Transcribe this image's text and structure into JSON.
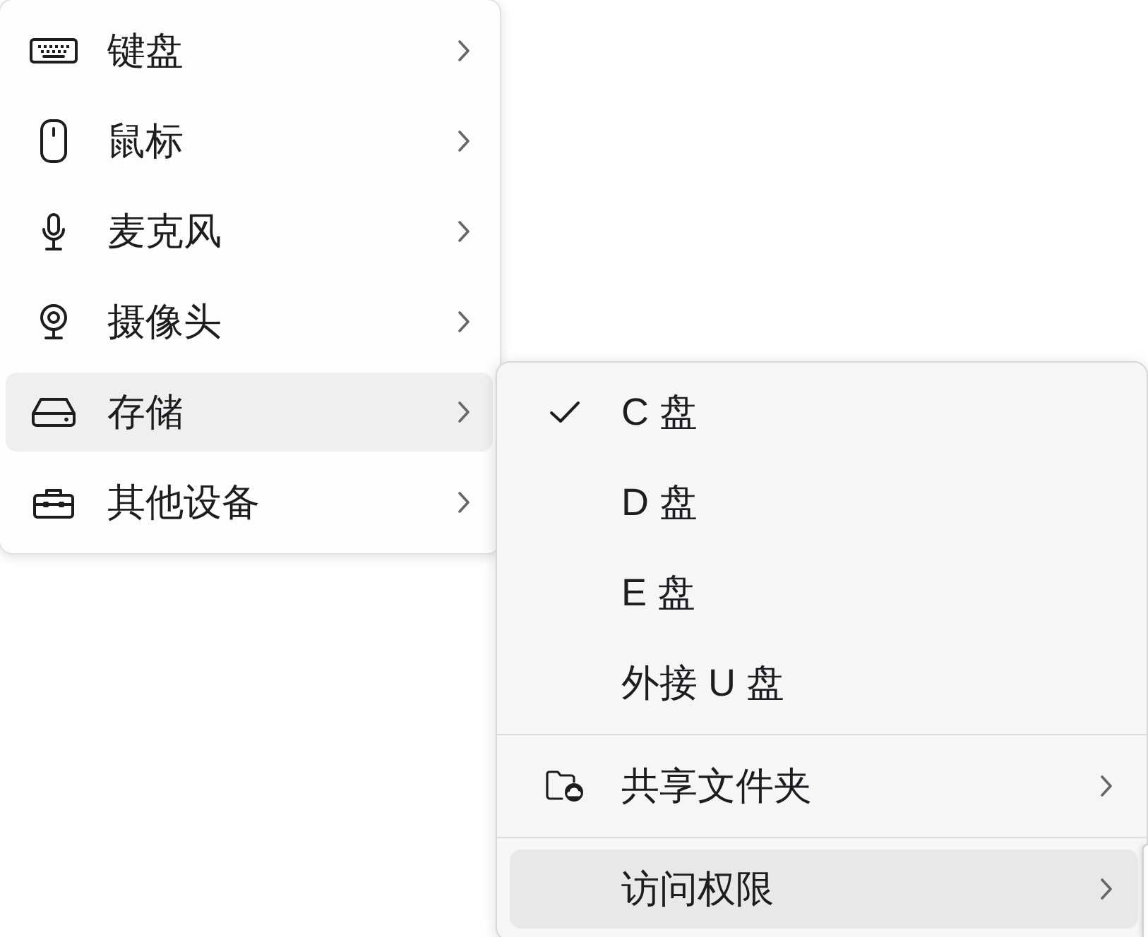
{
  "menu": {
    "items": [
      {
        "label": "键盘",
        "selected": false,
        "has_submenu": true
      },
      {
        "label": "鼠标",
        "selected": false,
        "has_submenu": true
      },
      {
        "label": "麦克风",
        "selected": false,
        "has_submenu": true
      },
      {
        "label": "摄像头",
        "selected": false,
        "has_submenu": true
      },
      {
        "label": "存储",
        "selected": true,
        "has_submenu": true
      },
      {
        "label": "其他设备",
        "selected": false,
        "has_submenu": true
      }
    ]
  },
  "submenu": {
    "groups": [
      {
        "items": [
          {
            "label": "C 盘",
            "checked": true,
            "selected": false,
            "has_submenu": false
          },
          {
            "label": "D 盘",
            "checked": false,
            "selected": false,
            "has_submenu": false
          },
          {
            "label": "E 盘",
            "checked": false,
            "selected": false,
            "has_submenu": false
          },
          {
            "label": "外接 U 盘",
            "checked": false,
            "selected": false,
            "has_submenu": false
          }
        ]
      },
      {
        "items": [
          {
            "label": "共享文件夹",
            "selected": false,
            "has_submenu": true
          }
        ]
      },
      {
        "items": [
          {
            "label": "访问权限",
            "selected": true,
            "has_submenu": true
          }
        ]
      }
    ]
  }
}
